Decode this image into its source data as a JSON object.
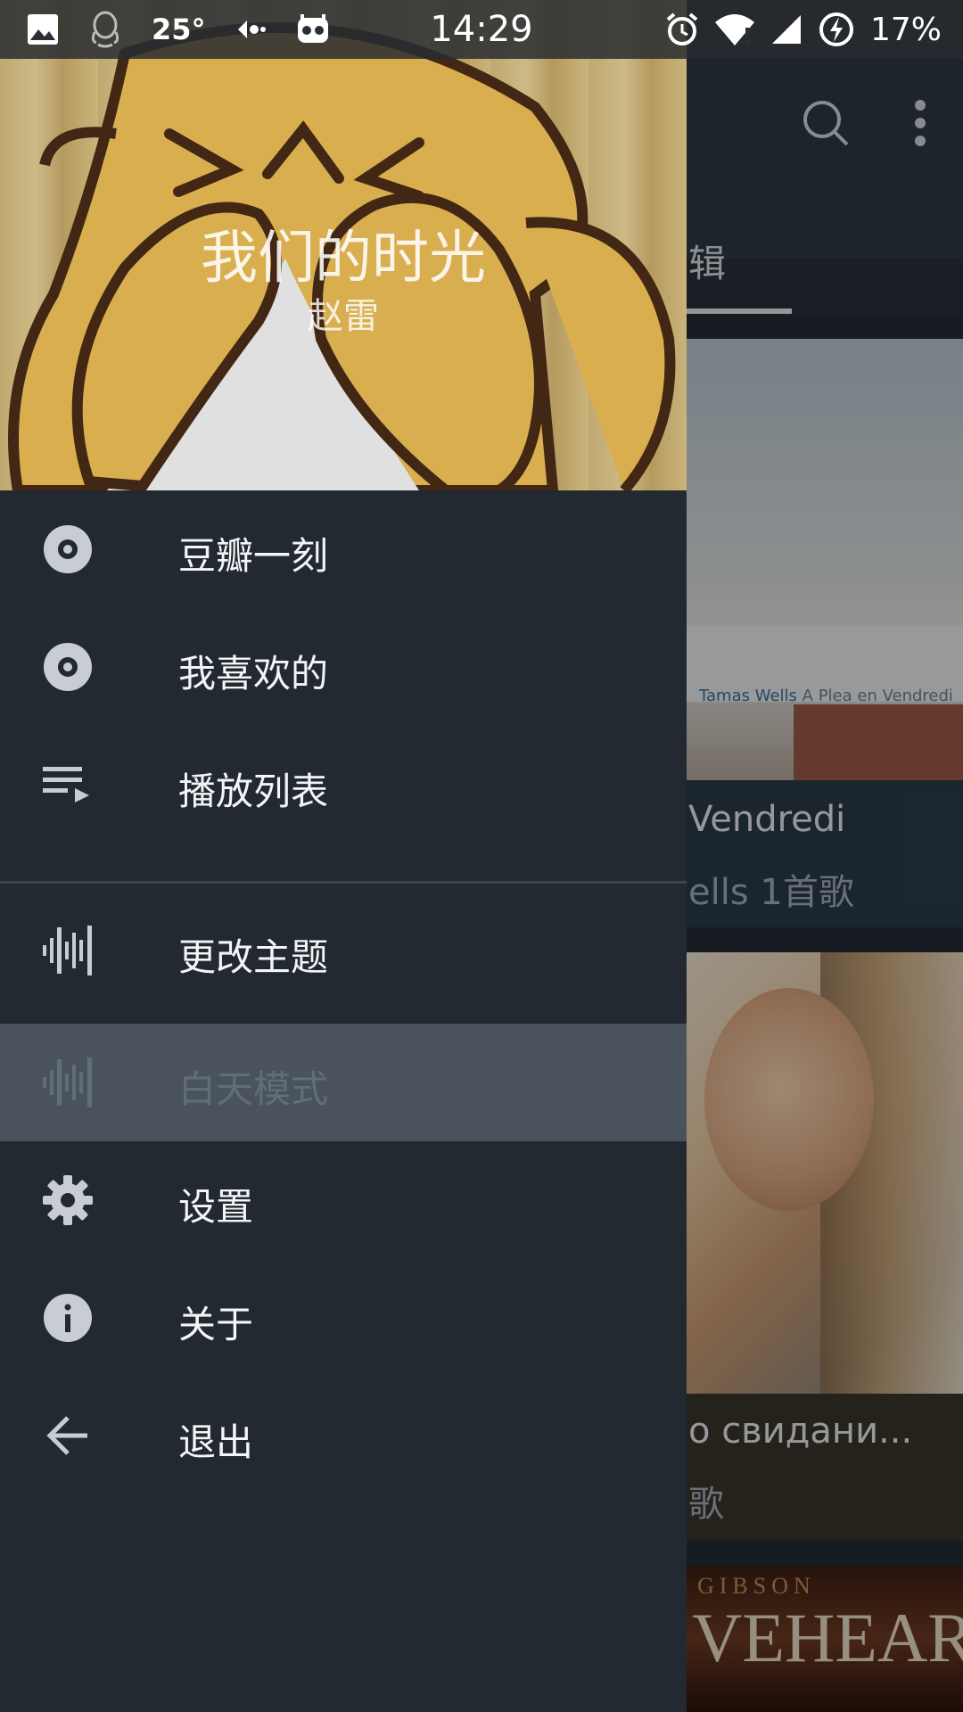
{
  "status_bar": {
    "temperature": "25°",
    "time": "14:29",
    "battery": "17%",
    "left_icons": [
      "image-icon",
      "qq-icon",
      "back-arrow-icon",
      "cyanogen-icon"
    ],
    "right_icons": [
      "alarm-icon",
      "wifi-icon",
      "signal-icon",
      "battery-charging-icon"
    ]
  },
  "drawer": {
    "header": {
      "song_title": "我们的时光",
      "artist": "赵雷"
    },
    "items": [
      {
        "label": "豆瓣一刻",
        "icon": "disc-icon"
      },
      {
        "label": "我喜欢的",
        "icon": "disc-icon"
      },
      {
        "label": "播放列表",
        "icon": "playlist-icon"
      },
      {
        "label": "更改主题",
        "icon": "waveform-icon"
      },
      {
        "label": "白天模式",
        "icon": "waveform-icon",
        "selected": true
      },
      {
        "label": "设置",
        "icon": "gear-icon"
      },
      {
        "label": "关于",
        "icon": "info-icon"
      },
      {
        "label": "退出",
        "icon": "arrow-back-icon"
      }
    ]
  },
  "background": {
    "tab_partial": "辑",
    "cards": [
      {
        "caption_artist": "Tamas Wells",
        "caption_album": "A Plea en Vendredi",
        "title": "Vendredi",
        "subtitle": "ells   1首歌"
      },
      {
        "title": "о свидани...",
        "subtitle": "歌"
      },
      {
        "art_line1": "GIBSON",
        "art_line2": "VEHEART"
      }
    ]
  }
}
